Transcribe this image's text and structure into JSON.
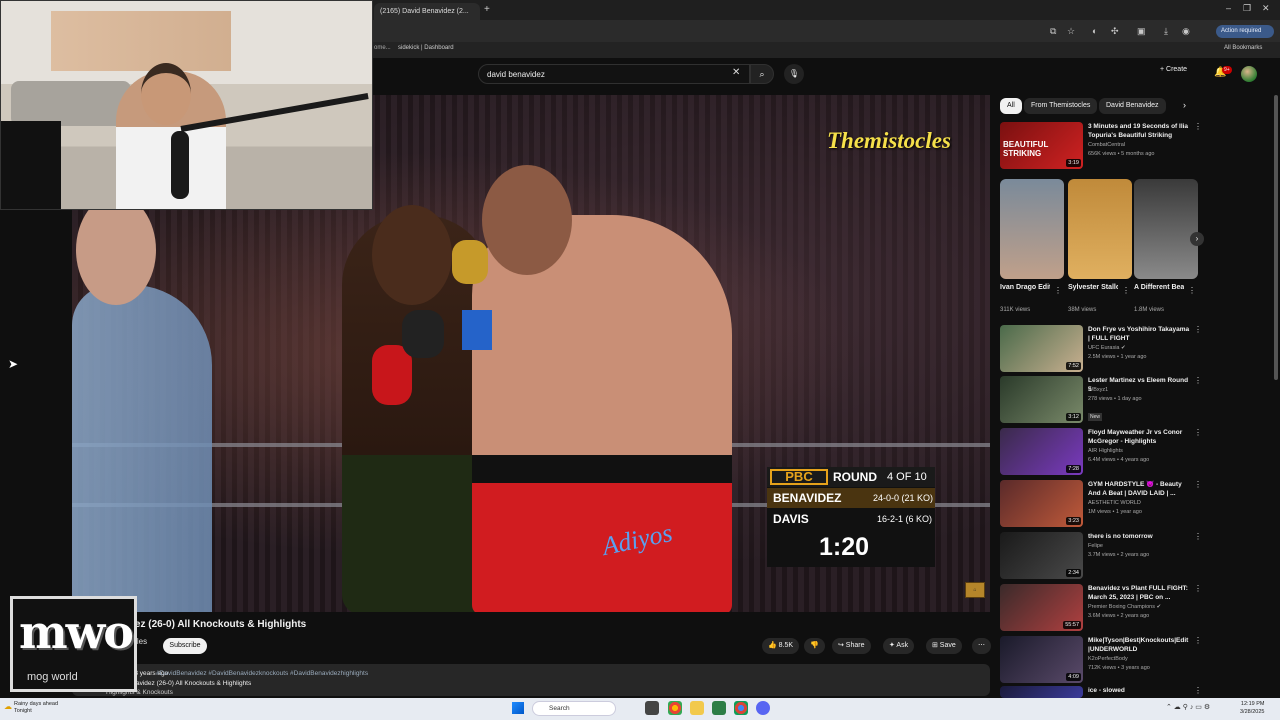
{
  "browser": {
    "tab_title": "(2165) David Benavidez (2...",
    "new_tab": "+",
    "window_controls": [
      "–",
      "❐",
      "✕"
    ],
    "action_required": "Action required",
    "bookmarks": [
      "ome...",
      "sidekick | Dashboard"
    ],
    "all_bookmarks": "All Bookmarks"
  },
  "header": {
    "search_query": "david benavidez",
    "clear_glyph": "✕",
    "search_glyph": "⌕",
    "mic_glyph": "🎙",
    "create_label": "+ Create",
    "notifications_badge": "9+"
  },
  "video": {
    "watermark": "Themistocles",
    "trunk_text": "Adiyos",
    "scorebug": {
      "logo": "PBC",
      "round_label": "ROUND",
      "round_of": "4 OF 10",
      "fighter1": "BENAVIDEZ",
      "record1": "24-0-0 (21 KO)",
      "fighter2": "DAVIS",
      "record2": "16-2-1 (6 KO)",
      "clock": "1:20"
    },
    "title": "Benavidez (26-0) All Knockouts & Highlights",
    "channel": "Themistocles",
    "subscribers": "subscribers",
    "subscribe_label": "Subscribe",
    "actions": {
      "likes": "👍 8.5K",
      "dislike": "👎",
      "share": "↪ Share",
      "ask": "✦ Ask",
      "save": "⊞ Save",
      "more": "⋯"
    },
    "description": {
      "meta": "1.1M views 3 years ago",
      "tags": "#DavidBenavidez #DavidBenavidezknockouts #DavidBenavidezhighlights",
      "line2": "David Benavidez (26-0) All Knockouts & Highlights",
      "line3": "Highlights & Knockouts"
    }
  },
  "logo": {
    "mark": "mwo",
    "text": "mog world"
  },
  "sidebar": {
    "chips": [
      "All",
      "From Themistocles",
      "David Benavidez"
    ],
    "chips_next": "›",
    "recommendations": [
      {
        "title": "3 Minutes and 19 Seconds of Ilia Topuria's Beautiful Striking",
        "channel": "CombatCentral",
        "meta": "656K views • 5 months ago",
        "duration": "3:19",
        "thumb_text": "BEAUTIFUL STRIKING",
        "colors": [
          "#7a1010",
          "#d02222"
        ]
      },
      {
        "title": "Don Frye vs Yoshihiro Takayama | FULL FIGHT",
        "channel": "UFC Eurasia ✔",
        "meta": "2.5M views • 1 year ago",
        "duration": "7:52",
        "colors": [
          "#4a6a4a",
          "#c9b090"
        ]
      },
      {
        "title": "Lester Martinez vs Eleem Round 5",
        "channel": "WBxyz1",
        "meta": "278 views • 1 day ago",
        "duration": "3:12",
        "new": "New",
        "colors": [
          "#2a3a2a",
          "#7a8a6a"
        ]
      },
      {
        "title": "Floyd Mayweather Jr vs Conor McGregor - Highlights",
        "channel": "AIR Highlights",
        "meta": "6.4M views • 4 years ago",
        "duration": "7:28",
        "colors": [
          "#3a2a4a",
          "#7a3ac0"
        ]
      },
      {
        "title": "GYM HARDSTYLE 😈 - Beauty And A Beat | DAVID LAID | ...",
        "channel": "AESTHETIC WORLD",
        "meta": "1M views • 1 year ago",
        "duration": "3:23",
        "colors": [
          "#5a2a2a",
          "#c05a3a"
        ]
      },
      {
        "title": "there is no tomorrow",
        "channel": "Felipe",
        "meta": "3.7M views • 2 years ago",
        "duration": "2:34",
        "colors": [
          "#1a1a1a",
          "#4a4a4a"
        ]
      },
      {
        "title": "Benavidez vs Plant FULL FIGHT: March 25, 2023 | PBC on ...",
        "channel": "Premier Boxing Champions ✔",
        "meta": "3.6M views • 2 years ago",
        "duration": "55:57",
        "colors": [
          "#3a2a2a",
          "#b04040"
        ]
      },
      {
        "title": "Mike|Tyson|Best|Knockouts|Edit |UNDERWORLD",
        "channel": "K2oPerfectBody",
        "meta": "712K views • 3 years ago",
        "duration": "4:09",
        "colors": [
          "#1a1a2a",
          "#5a4a6a"
        ]
      },
      {
        "title": "ice - slowed",
        "channel": "",
        "meta": "",
        "duration": "",
        "colors": [
          "#1a1a3a",
          "#3a3a9a"
        ]
      }
    ],
    "shorts": [
      {
        "title": "Ivan Drago Edit (\"Rock...",
        "views": "311K views",
        "colors": [
          "#7a8a9a",
          "#c0a08a"
        ]
      },
      {
        "title": "Sylvester Stallone ...",
        "views": "38M views",
        "colors": [
          "#c08a3a",
          "#e0b060"
        ]
      },
      {
        "title": "A Different Beast",
        "views": "1.8M views",
        "colors": [
          "#3a3a3a",
          "#8a8a8a"
        ]
      }
    ],
    "shorts_next": "›"
  },
  "taskbar": {
    "weather_line1": "Rainy days ahead",
    "weather_line2": "Tonight",
    "search_placeholder": "Search",
    "clock_time": "12:19 PM",
    "clock_date": "3/28/2025"
  }
}
